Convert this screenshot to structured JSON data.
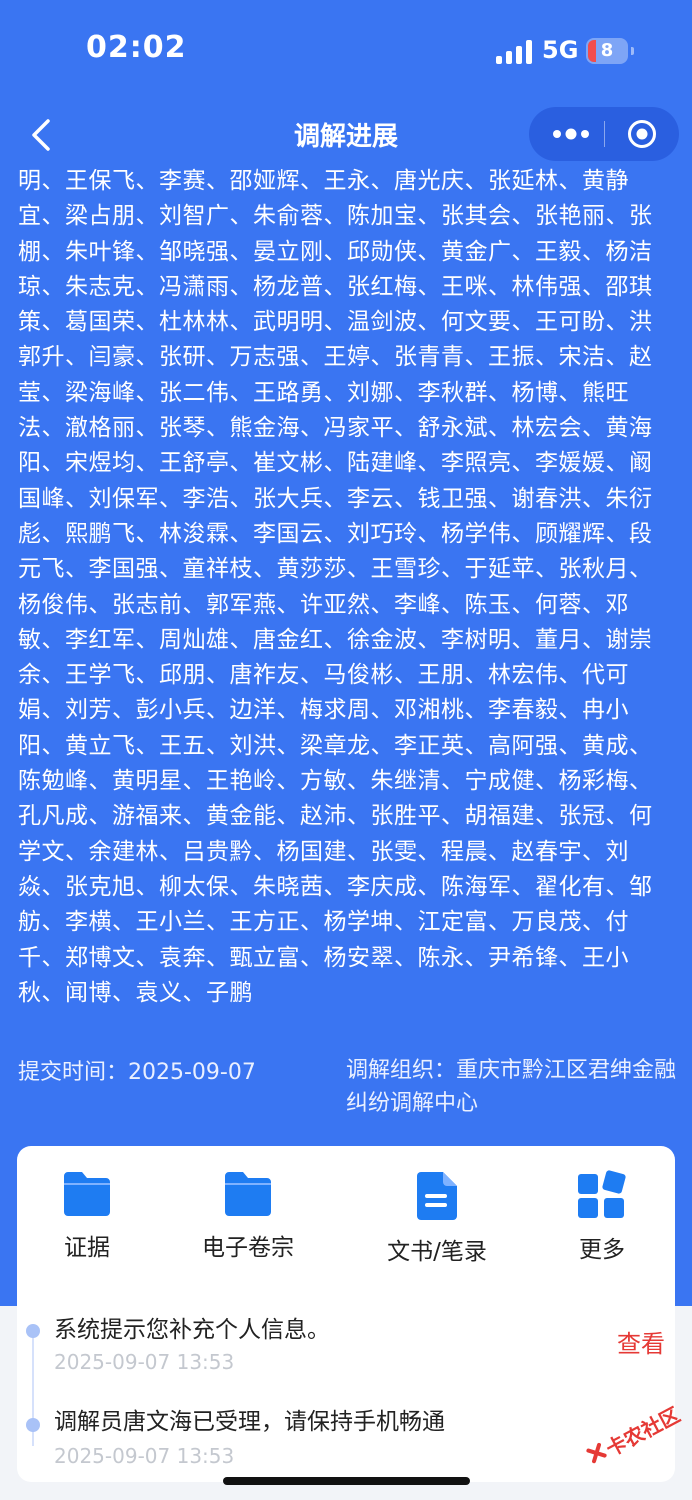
{
  "status_bar": {
    "time": "02:02",
    "network": "5G",
    "battery": "8"
  },
  "nav": {
    "title": "调解进展"
  },
  "names_text": "明、王保飞、李赛、邵娅辉、王永、唐光庆、张延林、黄静宜、梁占朋、刘智广、朱俞蓉、陈加宝、张其会、张艳丽、张棚、朱叶锋、邹晓强、晏立刚、邱勋侠、黄金广、王毅、杨洁琼、朱志克、冯潇雨、杨龙普、张红梅、王咪、林伟强、邵琪策、葛国荣、杜林林、武明明、温剑波、何文要、王可盼、洪郭升、闫豪、张研、万志强、王婷、张青青、王振、宋洁、赵莹、梁海峰、张二伟、王路勇、刘娜、李秋群、杨博、熊旺法、澈格丽、张琴、熊金海、冯家平、舒永斌、林宏会、黄海阳、宋煜均、王舒亭、崔文彬、陆建峰、李照亮、李媛媛、阚国峰、刘保军、李浩、张大兵、李云、钱卫强、谢春洪、朱衍彪、熙鹏飞、林浚霖、李国云、刘巧玲、杨学伟、顾耀辉、段元飞、李国强、童祥枝、黄莎莎、王雪珍、于延苹、张秋月、杨俊伟、张志前、郭军燕、许亚然、李峰、陈玉、何蓉、邓敏、李红军、周灿雄、唐金红、徐金波、李树明、董月、谢崇余、王学飞、邱朋、唐祚友、马俊彬、王朋、林宏伟、代可娟、刘芳、彭小兵、边洋、梅求周、邓湘桃、李春毅、冉小阳、黄立飞、王五、刘洪、梁章龙、李正英、高阿强、黄成、陈勉峰、黄明星、王艳岭、方敏、朱继清、宁成健、杨彩梅、孔凡成、游福来、黄金能、赵沛、张胜平、胡福建、张冠、何学文、余建林、吕贵黔、杨国建、张雯、程晨、赵春宇、刘焱、张克旭、柳太保、朱晓茜、李庆成、陈海军、翟化有、邹舫、李横、王小兰、王方正、杨学坤、江定富、万良茂、付千、郑博文、袁奔、甄立富、杨安翠、陈永、尹希锋、王小秋、闻博、袁义、子鹏",
  "info": {
    "submit_time": "提交时间：2025-09-07",
    "org": "调解组织：重庆市黔江区君绅金融纠纷调解中心"
  },
  "actions": [
    {
      "label": "证据"
    },
    {
      "label": "电子卷宗"
    },
    {
      "label": "文书/笔录"
    },
    {
      "label": "更多"
    }
  ],
  "timeline": [
    {
      "text": "系统提示您补充个人信息。",
      "time": "2025-09-07 13:53",
      "action": "查看"
    },
    {
      "text": "调解员唐文海已受理，请保持手机畅通",
      "time": "2025-09-07 13:53"
    }
  ],
  "watermark": {
    "text": "卡农社区"
  },
  "colors": {
    "primary": "#3a75f2",
    "icon_blue": "#1e7cf2",
    "alert_red": "#e53935"
  }
}
